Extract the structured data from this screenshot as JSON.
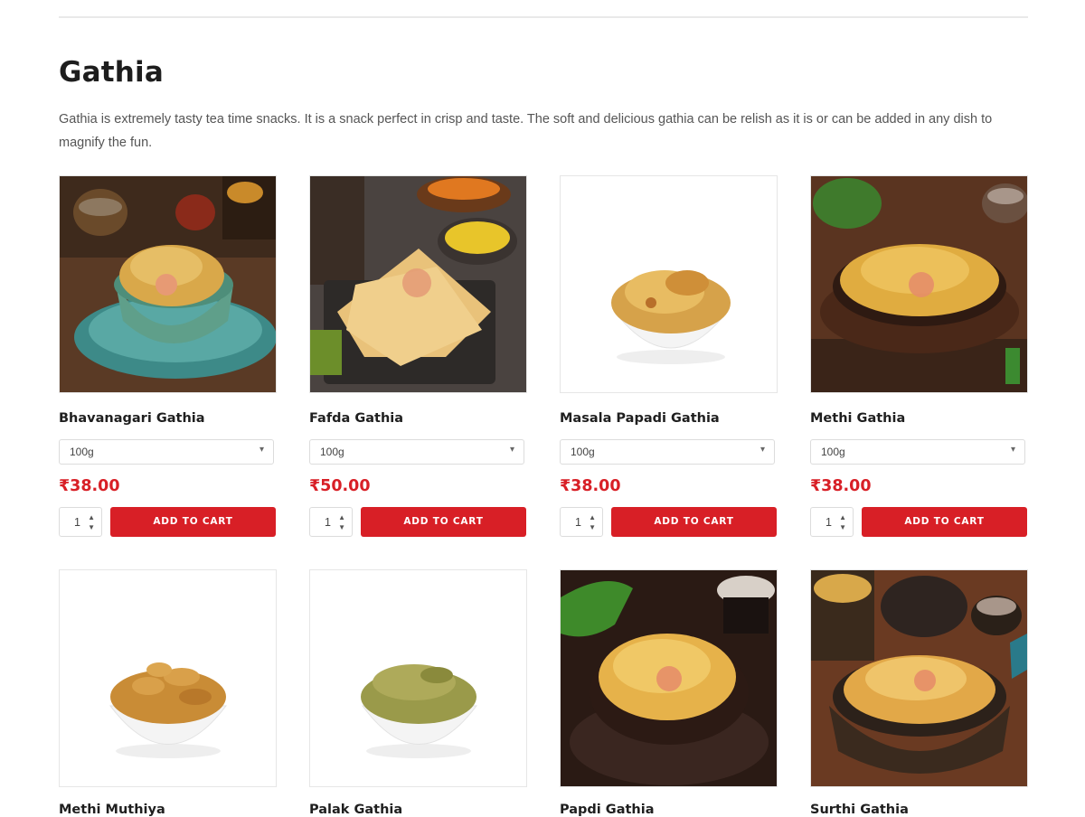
{
  "page": {
    "title": "Gathia",
    "description": "Gathia is extremely tasty tea time snacks. It is a snack perfect in crisp and taste. The soft and delicious gathia can be relish as it is or can be added in any dish to magnify the fun."
  },
  "products": [
    {
      "name": "Bhavanagari Gathia",
      "weight": "100g",
      "price": "₹38.00",
      "qty": "1",
      "cta": "ADD TO CART"
    },
    {
      "name": "Fafda Gathia",
      "weight": "100g",
      "price": "₹50.00",
      "qty": "1",
      "cta": "ADD TO CART"
    },
    {
      "name": "Masala Papadi Gathia",
      "weight": "100g",
      "price": "₹38.00",
      "qty": "1",
      "cta": "ADD TO CART"
    },
    {
      "name": "Methi Gathia",
      "weight": "100g",
      "price": "₹38.00",
      "qty": "1",
      "cta": "ADD TO CART"
    },
    {
      "name": "Methi Muthiya"
    },
    {
      "name": "Palak Gathia"
    },
    {
      "name": "Papdi Gathia"
    },
    {
      "name": "Surthi Gathia"
    }
  ],
  "colors": {
    "accent": "#d81f26",
    "price": "#d81f26"
  }
}
